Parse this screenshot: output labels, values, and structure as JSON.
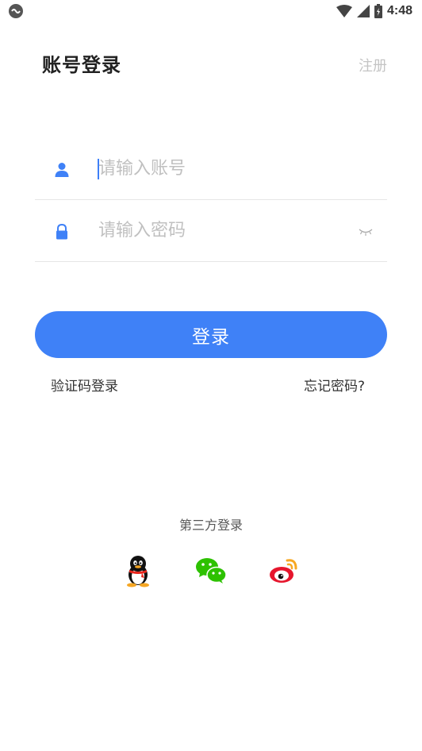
{
  "status_bar": {
    "left_icon": "app-notification-icon",
    "wifi_icon": "wifi-icon",
    "signal_icon": "signal-icon",
    "battery_icon": "battery-charging-icon",
    "time": "4:48"
  },
  "header": {
    "title": "账号登录",
    "register_label": "注册"
  },
  "form": {
    "account_placeholder": "请输入账号",
    "account_icon": "user-icon",
    "password_placeholder": "请输入密码",
    "password_icon": "lock-icon",
    "visibility_icon": "eye-closed-icon"
  },
  "actions": {
    "login_label": "登录",
    "sms_login_label": "验证码登录",
    "forgot_label": "忘记密码?"
  },
  "third_party": {
    "label": "第三方登录",
    "providers": [
      "qq-icon",
      "wechat-icon",
      "weibo-icon"
    ]
  },
  "colors": {
    "accent": "#3f81f7",
    "placeholder": "#c0c0c0",
    "divider": "#e6e6e6"
  }
}
